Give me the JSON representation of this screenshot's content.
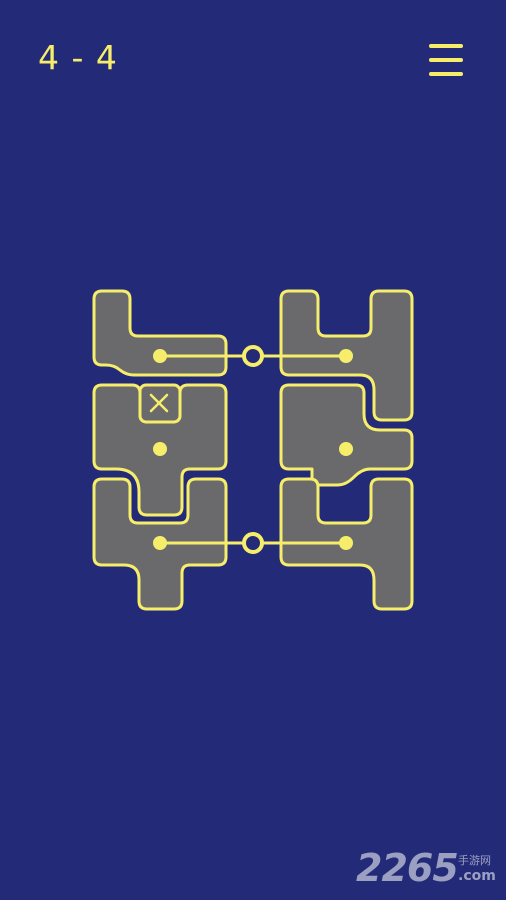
{
  "header": {
    "level_label": "4 - 4",
    "menu_icon": "hamburger-menu-icon"
  },
  "colors": {
    "background": "#232a78",
    "accent": "#f6ee6a",
    "piece_fill": "#6a6a6c"
  },
  "watermark": {
    "number": "2265",
    "sub": "手游网",
    "domain": ".com"
  }
}
